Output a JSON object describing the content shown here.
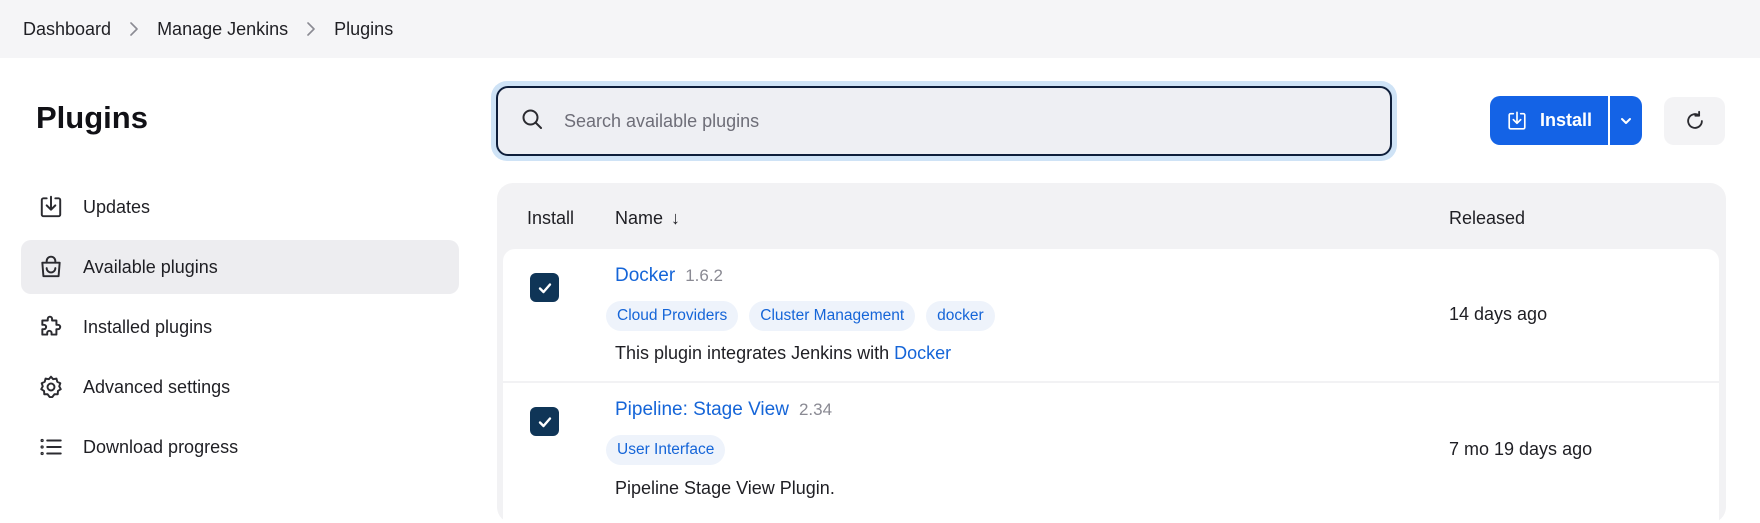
{
  "breadcrumb": {
    "items": [
      "Dashboard",
      "Manage Jenkins",
      "Plugins"
    ]
  },
  "sidebar": {
    "title": "Plugins",
    "items": [
      {
        "label": "Updates",
        "icon": "download-icon",
        "active": false
      },
      {
        "label": "Available plugins",
        "icon": "shopping-bag-icon",
        "active": true
      },
      {
        "label": "Installed plugins",
        "icon": "puzzle-icon",
        "active": false
      },
      {
        "label": "Advanced settings",
        "icon": "gear-icon",
        "active": false
      },
      {
        "label": "Download progress",
        "icon": "list-icon",
        "active": false
      }
    ]
  },
  "search": {
    "placeholder": "Search available plugins",
    "value": ""
  },
  "toolbar": {
    "install_label": "Install"
  },
  "table": {
    "headers": {
      "install": "Install",
      "name": "Name",
      "name_sort": "↓",
      "released": "Released"
    },
    "rows": [
      {
        "checked": true,
        "name": "Docker",
        "version": "1.6.2",
        "tags": [
          "Cloud Providers",
          "Cluster Management",
          "docker"
        ],
        "description_prefix": "This plugin integrates Jenkins with",
        "description_link": "Docker",
        "released": "14 days ago"
      },
      {
        "checked": true,
        "name": "Pipeline: Stage View",
        "version": "2.34",
        "tags": [
          "User Interface"
        ],
        "description_prefix": "Pipeline Stage View Plugin.",
        "description_link": "",
        "released": "7 mo 19 days ago"
      }
    ]
  },
  "colors": {
    "accent": "#1463e6",
    "link": "#1565d8",
    "checkbox": "#0f3557"
  }
}
